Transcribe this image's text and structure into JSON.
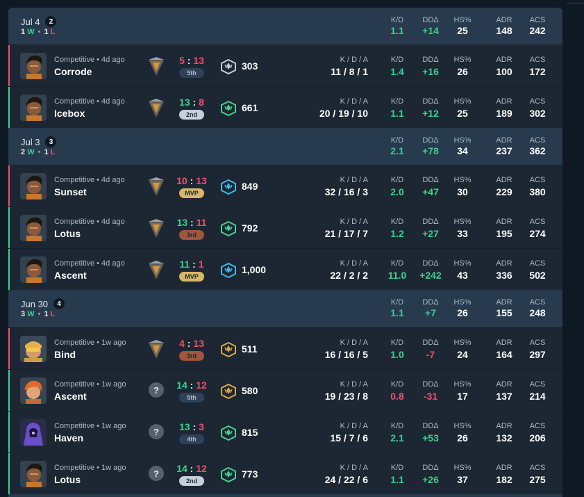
{
  "columns": {
    "kda": "K / D / A",
    "kd": "K/D",
    "dd": "DDΔ",
    "hs": "HS%",
    "adr": "ADR",
    "acs": "ACS"
  },
  "colors": {
    "win": "#3ecf8e",
    "loss": "#f0506e",
    "header_bg": "#273a4e",
    "row_bg": "#1c2733",
    "page_bg": "#0f1923"
  },
  "days": [
    {
      "date": "Jul 4",
      "count": "2",
      "wins": "1",
      "w_label": "W",
      "losses": "1",
      "l_label": "L",
      "stats": {
        "kd": "1.1",
        "dd": "+14",
        "hs": "25",
        "adr": "148",
        "acs": "242"
      },
      "matches": [
        {
          "result": "loss",
          "agent_icon": "agent-portrait-dark-hair",
          "mode": "Competitive • 4d ago",
          "map": "Corrode",
          "rank_icon": "diamond-rank-icon",
          "score_a": "5",
          "score_b": "13",
          "position": "5th",
          "pos_style": "gray",
          "rr_icon": "rr-badge-gray-icon",
          "rr": "303",
          "kda": "11 / 8 / 1",
          "kd": "1.4",
          "dd": "+16",
          "hs": "26",
          "adr": "100",
          "acs": "172"
        },
        {
          "result": "win",
          "agent_icon": "agent-portrait-dark-hair",
          "mode": "Competitive • 4d ago",
          "map": "Icebox",
          "rank_icon": "diamond-rank-icon",
          "score_a": "13",
          "score_b": "8",
          "position": "2nd",
          "pos_style": "light",
          "rr_icon": "rr-badge-green-icon",
          "rr": "661",
          "kda": "20 / 19 / 10",
          "kd": "1.1",
          "dd": "+12",
          "hs": "25",
          "adr": "189",
          "acs": "302"
        }
      ]
    },
    {
      "date": "Jul 3",
      "count": "3",
      "wins": "2",
      "w_label": "W",
      "losses": "1",
      "l_label": "L",
      "stats": {
        "kd": "2.1",
        "dd": "+78",
        "hs": "34",
        "adr": "237",
        "acs": "362"
      },
      "matches": [
        {
          "result": "loss",
          "agent_icon": "agent-portrait-dark-hair",
          "mode": "Competitive • 4d ago",
          "map": "Sunset",
          "rank_icon": "diamond-rank-icon",
          "score_a": "10",
          "score_b": "13",
          "position": "MVP",
          "pos_style": "gold",
          "rr_icon": "rr-badge-blue-icon",
          "rr": "849",
          "kda": "32 / 16 / 3",
          "kd": "2.0",
          "dd": "+47",
          "hs": "30",
          "adr": "229",
          "acs": "380"
        },
        {
          "result": "win",
          "agent_icon": "agent-portrait-dark-hair",
          "mode": "Competitive • 4d ago",
          "map": "Lotus",
          "rank_icon": "diamond-rank-icon",
          "score_a": "13",
          "score_b": "11",
          "position": "3rd",
          "pos_style": "bronze",
          "rr_icon": "rr-badge-green-icon",
          "rr": "792",
          "kda": "21 / 17 / 7",
          "kd": "1.2",
          "dd": "+27",
          "hs": "33",
          "adr": "195",
          "acs": "274"
        },
        {
          "result": "win",
          "agent_icon": "agent-portrait-dark-hair",
          "mode": "Competitive • 4d ago",
          "map": "Ascent",
          "rank_icon": "diamond-rank-icon",
          "score_a": "11",
          "score_b": "1",
          "position": "MVP",
          "pos_style": "gold",
          "rr_icon": "rr-badge-blue-icon",
          "rr": "1,000",
          "kda": "22 / 2 / 2",
          "kd": "11.0",
          "dd": "+242",
          "hs": "43",
          "adr": "336",
          "acs": "502"
        }
      ]
    },
    {
      "date": "Jun 30",
      "count": "4",
      "wins": "3",
      "w_label": "W",
      "losses": "1",
      "l_label": "L",
      "stats": {
        "kd": "1.1",
        "dd": "+7",
        "hs": "26",
        "adr": "155",
        "acs": "248"
      },
      "matches": [
        {
          "result": "loss",
          "agent_icon": "agent-portrait-goggles",
          "mode": "Competitive • 1w ago",
          "map": "Bind",
          "rank_icon": "diamond-rank-icon",
          "score_a": "4",
          "score_b": "13",
          "position": "3rd",
          "pos_style": "bronze",
          "rr_icon": "rr-badge-gold-icon",
          "rr": "511",
          "kda": "16 / 16 / 5",
          "kd": "1.0",
          "dd": "-7",
          "hs": "24",
          "adr": "164",
          "acs": "297"
        },
        {
          "result": "win",
          "agent_icon": "agent-portrait-orange-hair",
          "mode": "Competitive • 1w ago",
          "map": "Ascent",
          "rank_icon": "unknown-rank-icon",
          "score_a": "14",
          "score_b": "12",
          "position": "5th",
          "pos_style": "gray",
          "rr_icon": "rr-badge-gold-icon",
          "rr": "580",
          "kda": "19 / 23 / 8",
          "kd": "0.8",
          "dd": "-31",
          "hs": "17",
          "adr": "137",
          "acs": "214"
        },
        {
          "result": "win",
          "agent_icon": "agent-portrait-hooded",
          "mode": "Competitive • 1w ago",
          "map": "Haven",
          "rank_icon": "unknown-rank-icon",
          "score_a": "13",
          "score_b": "3",
          "position": "4th",
          "pos_style": "gray",
          "rr_icon": "rr-badge-green-icon",
          "rr": "815",
          "kda": "15 / 7 / 6",
          "kd": "2.1",
          "dd": "+53",
          "hs": "26",
          "adr": "132",
          "acs": "206"
        },
        {
          "result": "win",
          "agent_icon": "agent-portrait-dark-hair",
          "mode": "Competitive • 1w ago",
          "map": "Lotus",
          "rank_icon": "unknown-rank-icon",
          "score_a": "14",
          "score_b": "12",
          "position": "2nd",
          "pos_style": "light",
          "rr_icon": "rr-badge-green-icon",
          "rr": "773",
          "kda": "24 / 22 / 6",
          "kd": "1.1",
          "dd": "+26",
          "hs": "37",
          "adr": "182",
          "acs": "275"
        }
      ]
    }
  ]
}
